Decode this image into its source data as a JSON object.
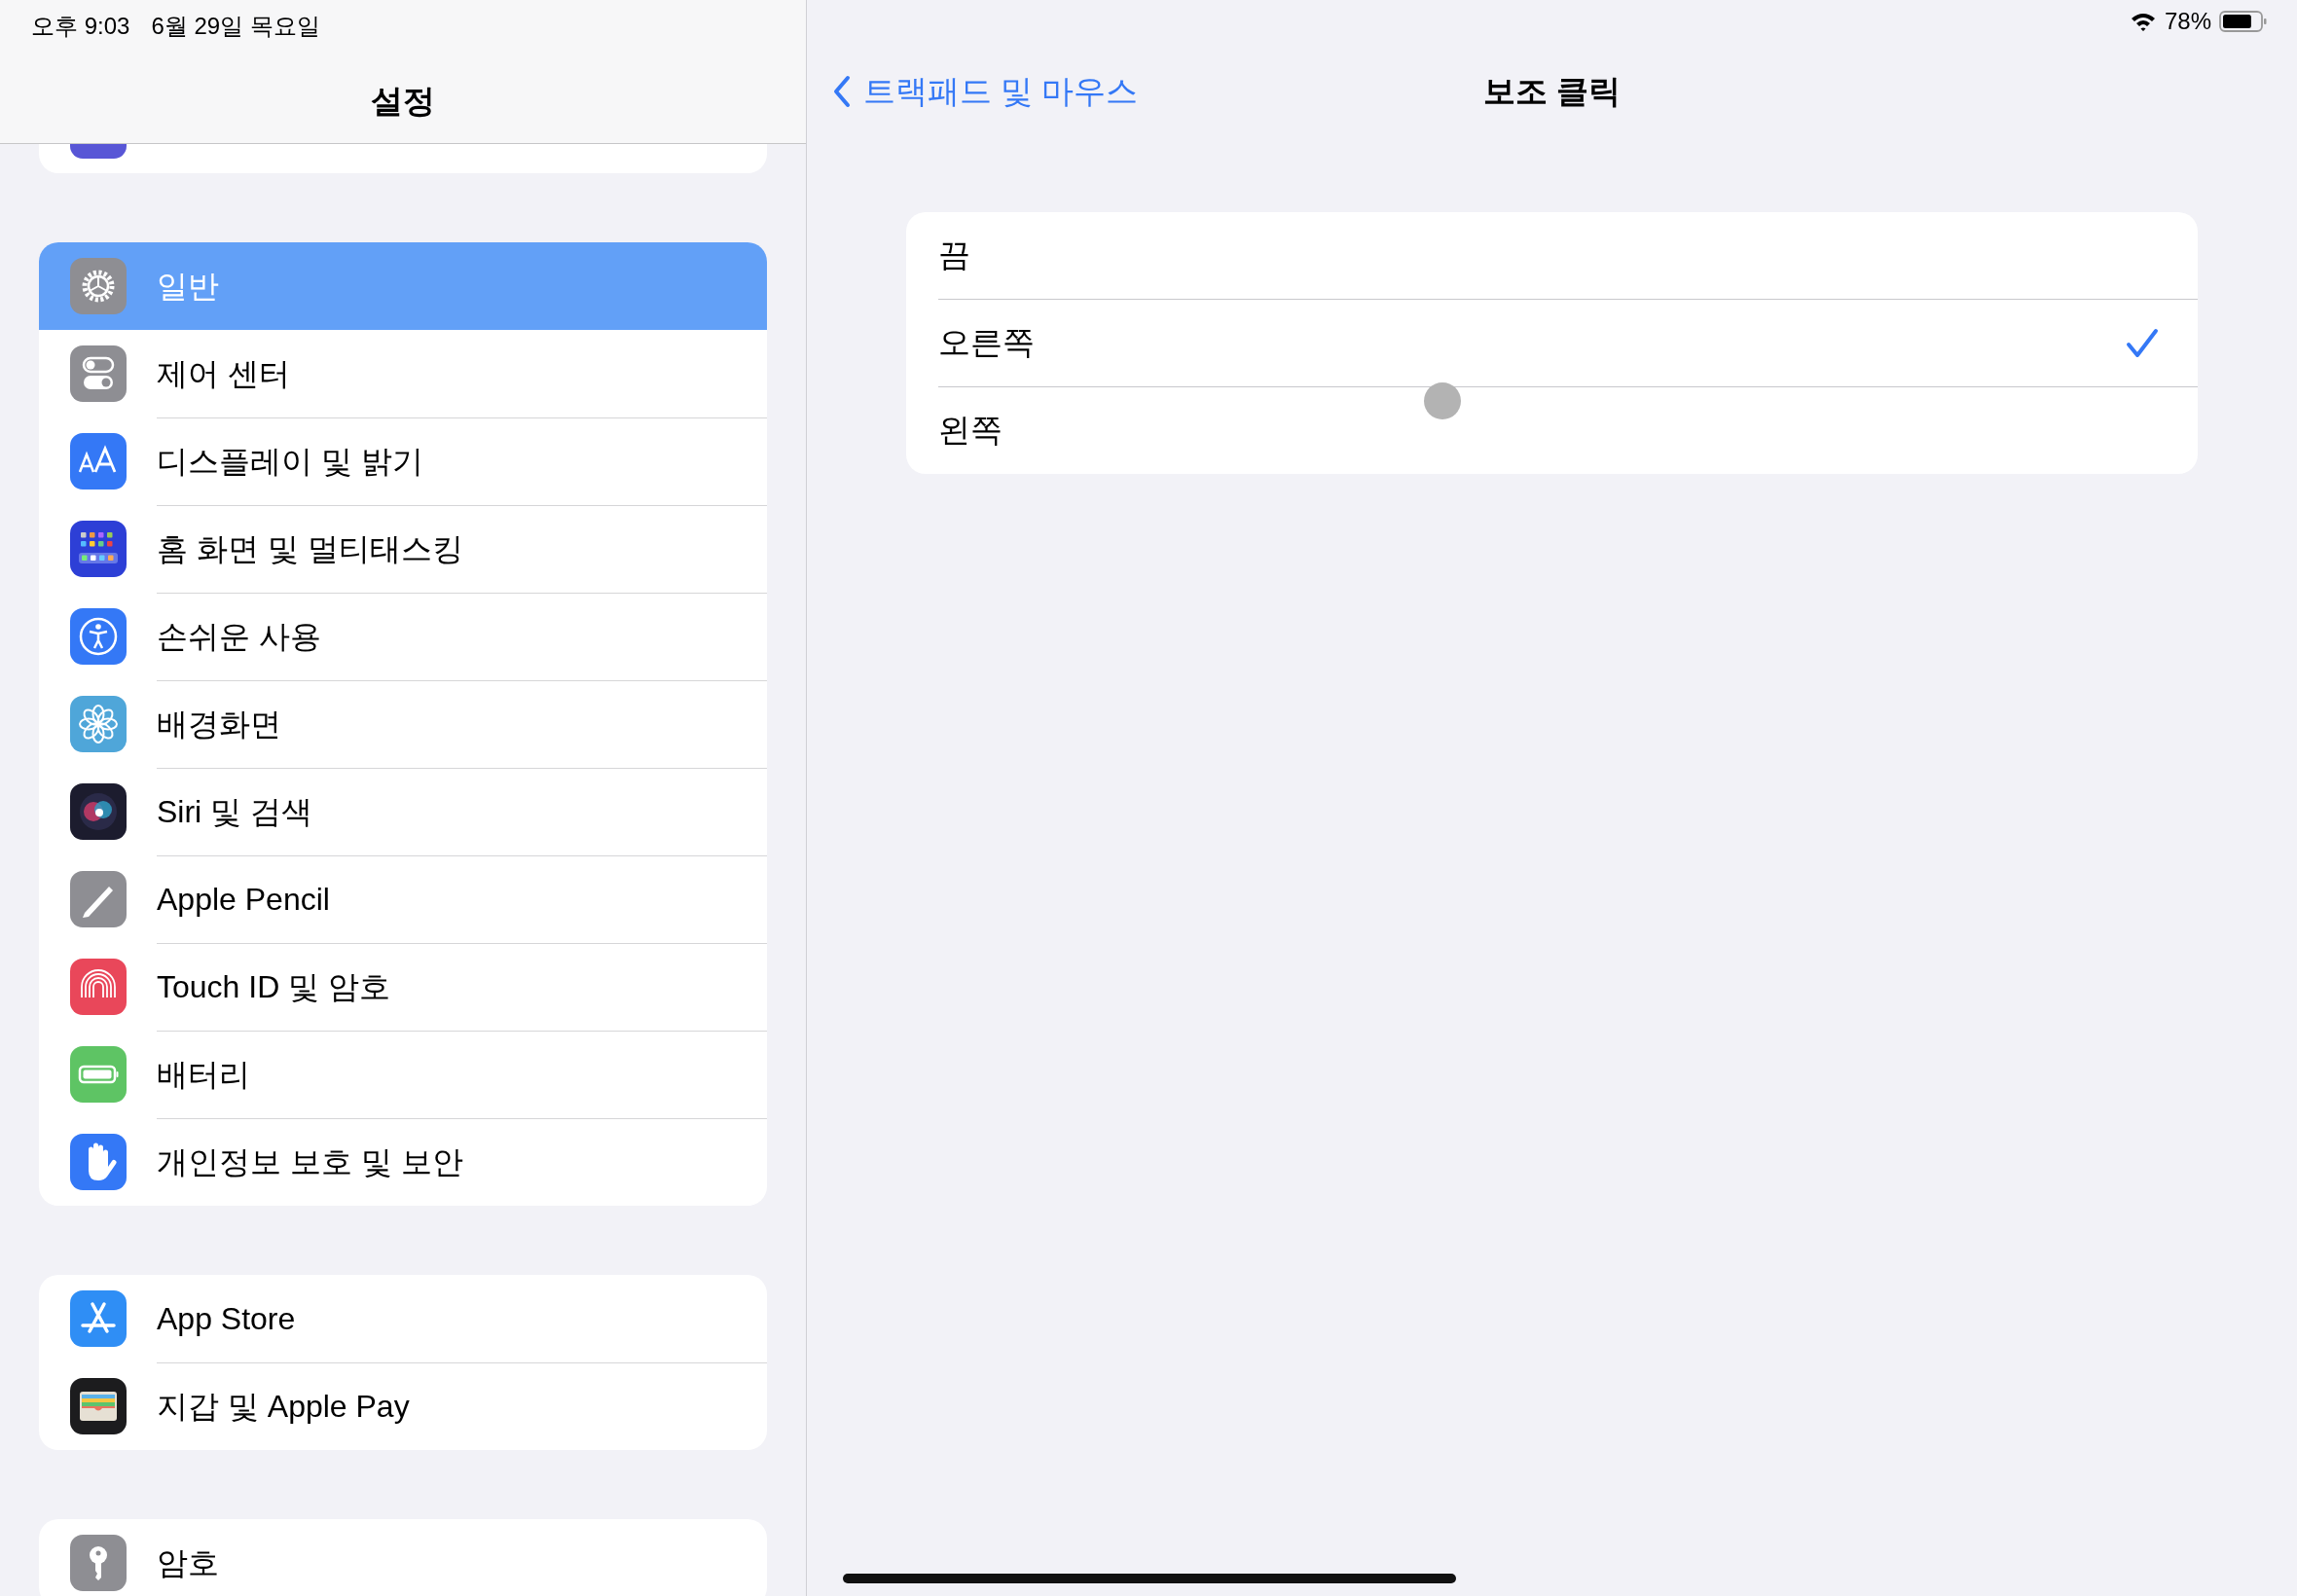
{
  "status_bar": {
    "time": "오후 9:03",
    "date": "6월 29일 목요일",
    "battery": "78%"
  },
  "sidebar": {
    "title": "설정",
    "groups": [
      {
        "items": [
          {
            "label": "일반",
            "kind": "gear",
            "selected": true
          },
          {
            "label": "제어 센터",
            "kind": "toggles",
            "selected": false
          },
          {
            "label": "디스플레이 및 밝기",
            "kind": "textsize",
            "selected": false
          },
          {
            "label": "홈 화면 및 멀티태스킹",
            "kind": "grid",
            "selected": false
          },
          {
            "label": "손쉬운 사용",
            "kind": "accessibility",
            "selected": false
          },
          {
            "label": "배경화면",
            "kind": "flower",
            "selected": false
          },
          {
            "label": "Siri 및 검색",
            "kind": "orb",
            "selected": false
          },
          {
            "label": "Apple Pencil",
            "kind": "pencil",
            "selected": false
          },
          {
            "label": "Touch ID 및 암호",
            "kind": "fingerprint",
            "selected": false
          },
          {
            "label": "배터리",
            "kind": "battery",
            "selected": false
          },
          {
            "label": "개인정보 보호 및 보안",
            "kind": "hand",
            "selected": false
          }
        ]
      },
      {
        "items": [
          {
            "label": "App Store",
            "kind": "store",
            "selected": false
          },
          {
            "label": "지갑 및 Apple Pay",
            "kind": "wallet",
            "selected": false
          }
        ]
      },
      {
        "items": [
          {
            "label": "암호",
            "kind": "key",
            "selected": false
          }
        ]
      }
    ]
  },
  "detail": {
    "back_label": "트랙패드 및 마우스",
    "title": "보조 클릭",
    "options": [
      {
        "label": "끔",
        "selected": false
      },
      {
        "label": "오른쪽",
        "selected": true
      },
      {
        "label": "왼쪽",
        "selected": false
      }
    ]
  }
}
